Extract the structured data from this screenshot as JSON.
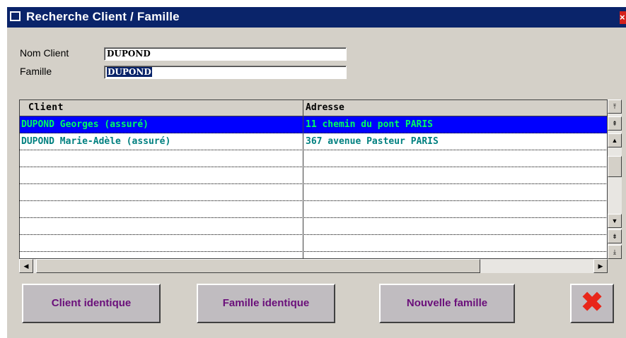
{
  "window": {
    "title": "Recherche Client / Famille"
  },
  "form": {
    "nom_client_label": "Nom Client",
    "nom_client_value": "DUPOND",
    "famille_label": "Famille",
    "famille_value": "DUPOND"
  },
  "table": {
    "columns": [
      "Client",
      "Adresse"
    ],
    "rows": [
      {
        "client": "DUPOND Georges (assuré)",
        "adresse": "11 chemin du pont PARIS",
        "selected": true
      },
      {
        "client": "DUPOND Marie-Adèle (assuré)",
        "adresse": "367 avenue Pasteur PARIS",
        "selected": false
      }
    ]
  },
  "buttons": {
    "client_identique": "Client identique",
    "famille_identique": "Famille identique",
    "nouvelle_famille": "Nouvelle famille",
    "cancel_icon": "close-x-icon"
  },
  "colors": {
    "titlebar": "#0a246a",
    "selected_row_bg": "#0000ff",
    "selected_row_text": "#00ff60",
    "row_text": "#008080",
    "button_text": "#6a0f7a",
    "cancel_icon": "#e8261a"
  }
}
